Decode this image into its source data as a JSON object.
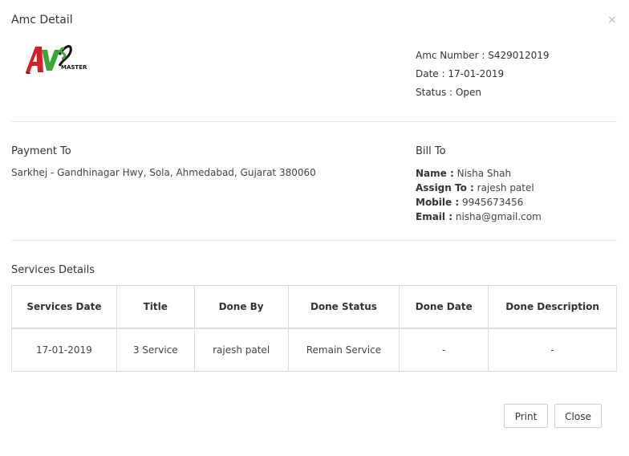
{
  "modal": {
    "title": "Amc Detail",
    "close_glyph": "×"
  },
  "logo": {
    "text": "MASTER",
    "icon": "amc-master-logo",
    "colors": {
      "red": "#d42027",
      "green": "#3aa637",
      "black": "#111111"
    }
  },
  "meta": {
    "amc_number_label": "Amc Number :",
    "amc_number": "S429012019",
    "date_label": "Date :",
    "date": "17-01-2019",
    "status_label": "Status :",
    "status": "Open"
  },
  "payment_to": {
    "heading": "Payment To",
    "address": "Sarkhej - Gandhinagar Hwy, Sola, Ahmedabad, Gujarat 380060"
  },
  "bill_to": {
    "heading": "Bill To",
    "name_label": "Name :",
    "name": "Nisha Shah",
    "assign_label": "Assign To :",
    "assign": "rajesh patel",
    "mobile_label": "Mobile :",
    "mobile": "9945673456",
    "email_label": "Email :",
    "email": "nisha@gmail.com"
  },
  "services": {
    "heading": "Services Details",
    "columns": [
      "Services Date",
      "Title",
      "Done By",
      "Done Status",
      "Done Date",
      "Done Description"
    ],
    "rows": [
      [
        "17-01-2019",
        "3 Service",
        "rajesh patel",
        "Remain Service",
        "-",
        "-"
      ]
    ]
  },
  "buttons": {
    "print": "Print",
    "close": "Close"
  }
}
